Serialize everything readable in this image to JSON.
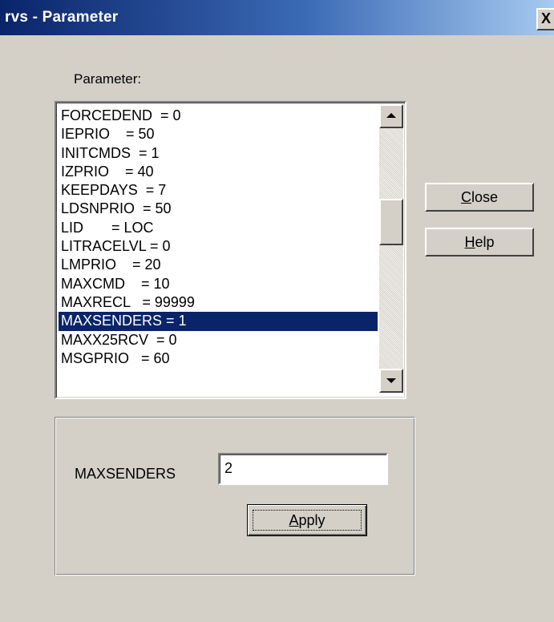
{
  "window": {
    "title": "rvs - Parameter",
    "close_glyph": "X"
  },
  "parameter_label": "Parameter:",
  "parameter_list": {
    "items": [
      "FORCEDEND  = 0",
      "IEPRIO    = 50",
      "INITCMDS  = 1",
      "IZPRIO    = 40",
      "KEEPDAYS  = 7",
      "LDSNPRIO  = 50",
      "LID       = LOC",
      "LITRACELVL = 0",
      "LMPRIO    = 20",
      "MAXCMD    = 10",
      "MAXRECL   = 99999",
      "MAXSENDERS = 1",
      "MAXX25RCV  = 0",
      "MSGPRIO   = 60"
    ],
    "selected_index": 11,
    "selected_color": "#0a246a"
  },
  "buttons": {
    "close_mnemonic": "C",
    "close_rest": "lose",
    "help_mnemonic": "H",
    "help_rest": "elp",
    "apply_mnemonic": "A",
    "apply_rest": "pply"
  },
  "editor": {
    "label": "MAXSENDERS",
    "value": "2"
  },
  "colors": {
    "titlebar_start": "#0a246a",
    "titlebar_end": "#a6caf0",
    "face": "#d4d0c8"
  }
}
